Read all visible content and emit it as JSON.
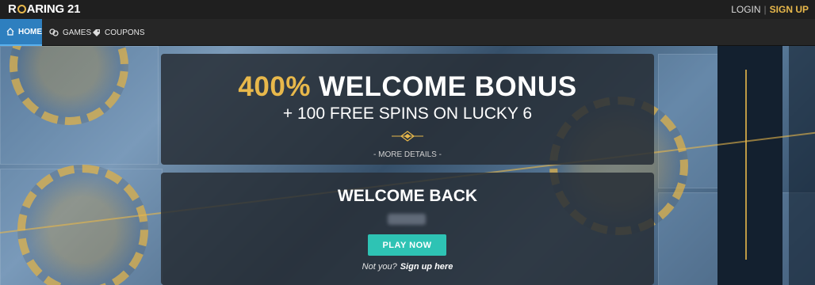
{
  "brand": {
    "logo_part1": "R",
    "logo_part2": "ARING 21"
  },
  "header": {
    "login_label": "LOGIN",
    "separator": "|",
    "signup_label": "SIGN UP"
  },
  "nav": {
    "items": [
      {
        "label": "HOME",
        "icon": "home-icon"
      },
      {
        "label": "GAMES",
        "icon": "chips-icon"
      },
      {
        "label": "COUPONS",
        "icon": "tag-icon"
      }
    ]
  },
  "promo": {
    "highlight": "400%",
    "title_rest": " WELCOME BONUS",
    "subtitle": "+ 100 FREE SPINS ON LUCKY 6",
    "more_details": "- MORE DETAILS -"
  },
  "welcome": {
    "title": "WELCOME BACK",
    "play_button": "PLAY NOW",
    "not_you": "Not you?",
    "sign_up_link": "Sign up here"
  },
  "colors": {
    "accent_gold": "#e8b84b",
    "play_teal": "#2ec3b4",
    "nav_active": "#2e7fbf"
  }
}
